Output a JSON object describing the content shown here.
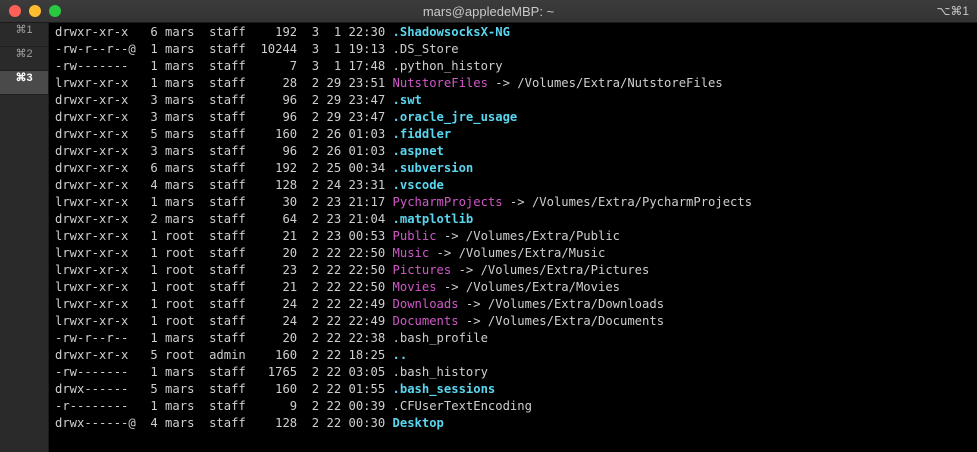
{
  "window": {
    "title": "mars@appledeMBP: ~",
    "shortcut": "⌥⌘1",
    "colors": {
      "directory": "#5ad7f0",
      "symlink": "#d257c9",
      "text": "#cfcfcf",
      "background": "#000000"
    }
  },
  "tabs": [
    "⌘1",
    "⌘2",
    "⌘3"
  ],
  "active_tab": 2,
  "listing": [
    {
      "meta": "drwxr-xr-x   6 mars  staff    192  3  1 22:30 ",
      "name": ".ShadowsocksX-NG",
      "kind": "dir",
      "target": ""
    },
    {
      "meta": "-rw-r--r--@  1 mars  staff  10244  3  1 19:13 ",
      "name": ".DS_Store",
      "kind": "file",
      "target": ""
    },
    {
      "meta": "-rw-------   1 mars  staff      7  3  1 17:48 ",
      "name": ".python_history",
      "kind": "file",
      "target": ""
    },
    {
      "meta": "lrwxr-xr-x   1 mars  staff     28  2 29 23:51 ",
      "name": "NutstoreFiles",
      "kind": "link",
      "target": " -> /Volumes/Extra/NutstoreFiles"
    },
    {
      "meta": "drwxr-xr-x   3 mars  staff     96  2 29 23:47 ",
      "name": ".swt",
      "kind": "dir",
      "target": ""
    },
    {
      "meta": "drwxr-xr-x   3 mars  staff     96  2 29 23:47 ",
      "name": ".oracle_jre_usage",
      "kind": "dir",
      "target": ""
    },
    {
      "meta": "drwxr-xr-x   5 mars  staff    160  2 26 01:03 ",
      "name": ".fiddler",
      "kind": "dir",
      "target": ""
    },
    {
      "meta": "drwxr-xr-x   3 mars  staff     96  2 26 01:03 ",
      "name": ".aspnet",
      "kind": "dir",
      "target": ""
    },
    {
      "meta": "drwxr-xr-x   6 mars  staff    192  2 25 00:34 ",
      "name": ".subversion",
      "kind": "dir",
      "target": ""
    },
    {
      "meta": "drwxr-xr-x   4 mars  staff    128  2 24 23:31 ",
      "name": ".vscode",
      "kind": "dir",
      "target": ""
    },
    {
      "meta": "lrwxr-xr-x   1 mars  staff     30  2 23 21:17 ",
      "name": "PycharmProjects",
      "kind": "link",
      "target": " -> /Volumes/Extra/PycharmProjects"
    },
    {
      "meta": "drwxr-xr-x   2 mars  staff     64  2 23 21:04 ",
      "name": ".matplotlib",
      "kind": "dir",
      "target": ""
    },
    {
      "meta": "lrwxr-xr-x   1 root  staff     21  2 23 00:53 ",
      "name": "Public",
      "kind": "link",
      "target": " -> /Volumes/Extra/Public"
    },
    {
      "meta": "lrwxr-xr-x   1 root  staff     20  2 22 22:50 ",
      "name": "Music",
      "kind": "link",
      "target": " -> /Volumes/Extra/Music"
    },
    {
      "meta": "lrwxr-xr-x   1 root  staff     23  2 22 22:50 ",
      "name": "Pictures",
      "kind": "link",
      "target": " -> /Volumes/Extra/Pictures"
    },
    {
      "meta": "lrwxr-xr-x   1 root  staff     21  2 22 22:50 ",
      "name": "Movies",
      "kind": "link",
      "target": " -> /Volumes/Extra/Movies"
    },
    {
      "meta": "lrwxr-xr-x   1 root  staff     24  2 22 22:49 ",
      "name": "Downloads",
      "kind": "link",
      "target": " -> /Volumes/Extra/Downloads"
    },
    {
      "meta": "lrwxr-xr-x   1 root  staff     24  2 22 22:49 ",
      "name": "Documents",
      "kind": "link",
      "target": " -> /Volumes/Extra/Documents"
    },
    {
      "meta": "-rw-r--r--   1 mars  staff     20  2 22 22:38 ",
      "name": ".bash_profile",
      "kind": "file",
      "target": ""
    },
    {
      "meta": "drwxr-xr-x   5 root  admin    160  2 22 18:25 ",
      "name": "..",
      "kind": "dir",
      "target": ""
    },
    {
      "meta": "-rw-------   1 mars  staff   1765  2 22 03:05 ",
      "name": ".bash_history",
      "kind": "file",
      "target": ""
    },
    {
      "meta": "drwx------   5 mars  staff    160  2 22 01:55 ",
      "name": ".bash_sessions",
      "kind": "dir",
      "target": ""
    },
    {
      "meta": "-r--------   1 mars  staff      9  2 22 00:39 ",
      "name": ".CFUserTextEncoding",
      "kind": "file",
      "target": ""
    },
    {
      "meta": "drwx------@  4 mars  staff    128  2 22 00:30 ",
      "name": "Desktop",
      "kind": "dir",
      "target": ""
    }
  ]
}
